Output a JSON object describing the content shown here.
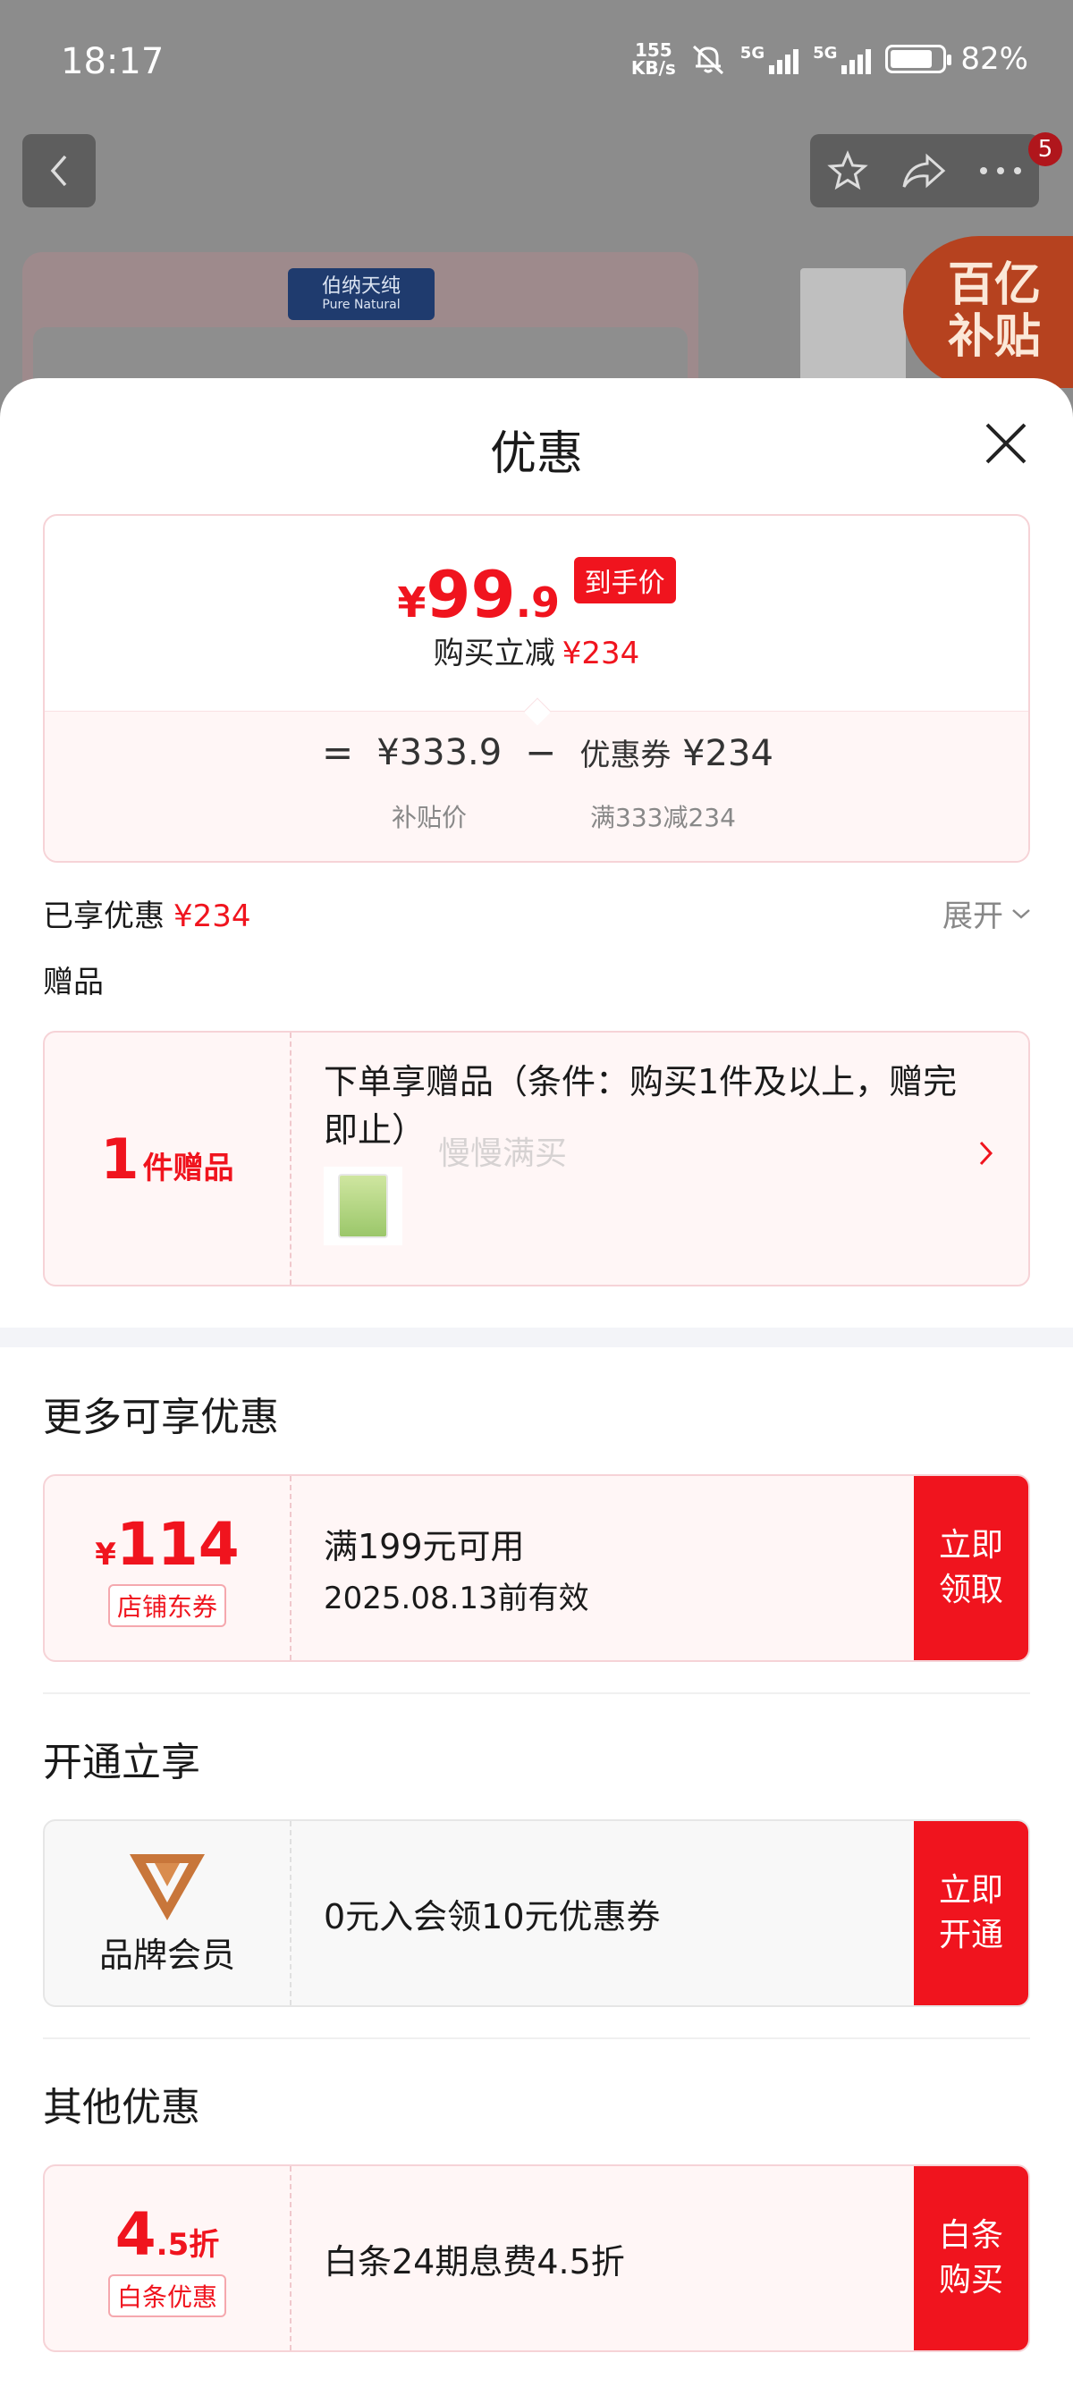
{
  "status_bar": {
    "time": "18:17",
    "net_speed_value": "155",
    "net_speed_unit": "KB/s",
    "sim1": "5G",
    "sim2": "5G",
    "battery_percent": "82%",
    "battery_level": 0.82
  },
  "background_page": {
    "cart_badge": "5",
    "brand_logo_cn": "伯纳天纯",
    "brand_logo_en": "Pure Natural",
    "subsidy_badge": "百亿补贴"
  },
  "sheet": {
    "title": "优惠",
    "price_card": {
      "yen": "¥",
      "price_int": "99",
      "price_dec": ".9",
      "price_tag": "到手价",
      "discount_label": "购买立减",
      "discount_value": "¥234",
      "equals": "=",
      "subsidy_price": "¥333.9",
      "minus": "−",
      "coupon_label": "优惠券",
      "coupon_value": "¥234",
      "subsidy_price_caption": "补贴价",
      "coupon_caption": "满333减234"
    },
    "enjoyed_label": "已享优惠",
    "enjoyed_value": "¥234",
    "expand_label": "展开",
    "gift_section_label": "赠品",
    "gift_card": {
      "count": "1",
      "count_unit": "件赠品",
      "description": "下单享赠品（条件：购买1件及以上，赠完即止）"
    },
    "watermark": "慢慢满买",
    "more_section_title": "更多可享优惠",
    "store_coupon": {
      "yen": "¥",
      "amount": "114",
      "tag": "店铺东券",
      "condition": "满199元可用",
      "validity": "2025.08.13前有效",
      "cta": "立即领取"
    },
    "membership_section_title": "开通立享",
    "membership": {
      "label": "品牌会员",
      "description": "0元入会领10元优惠券",
      "cta": "立即开通"
    },
    "other_section_title": "其他优惠",
    "baitiao": {
      "amount": "4",
      "amount_dec": ".5",
      "unit": "折",
      "tag": "白条优惠",
      "description": "白条24期息费4.5折",
      "cta": "白条购买"
    }
  },
  "colors": {
    "accent_red": "#f0141e",
    "pink_bg": "#fff6f6",
    "vip_gold": "#c8763a"
  }
}
